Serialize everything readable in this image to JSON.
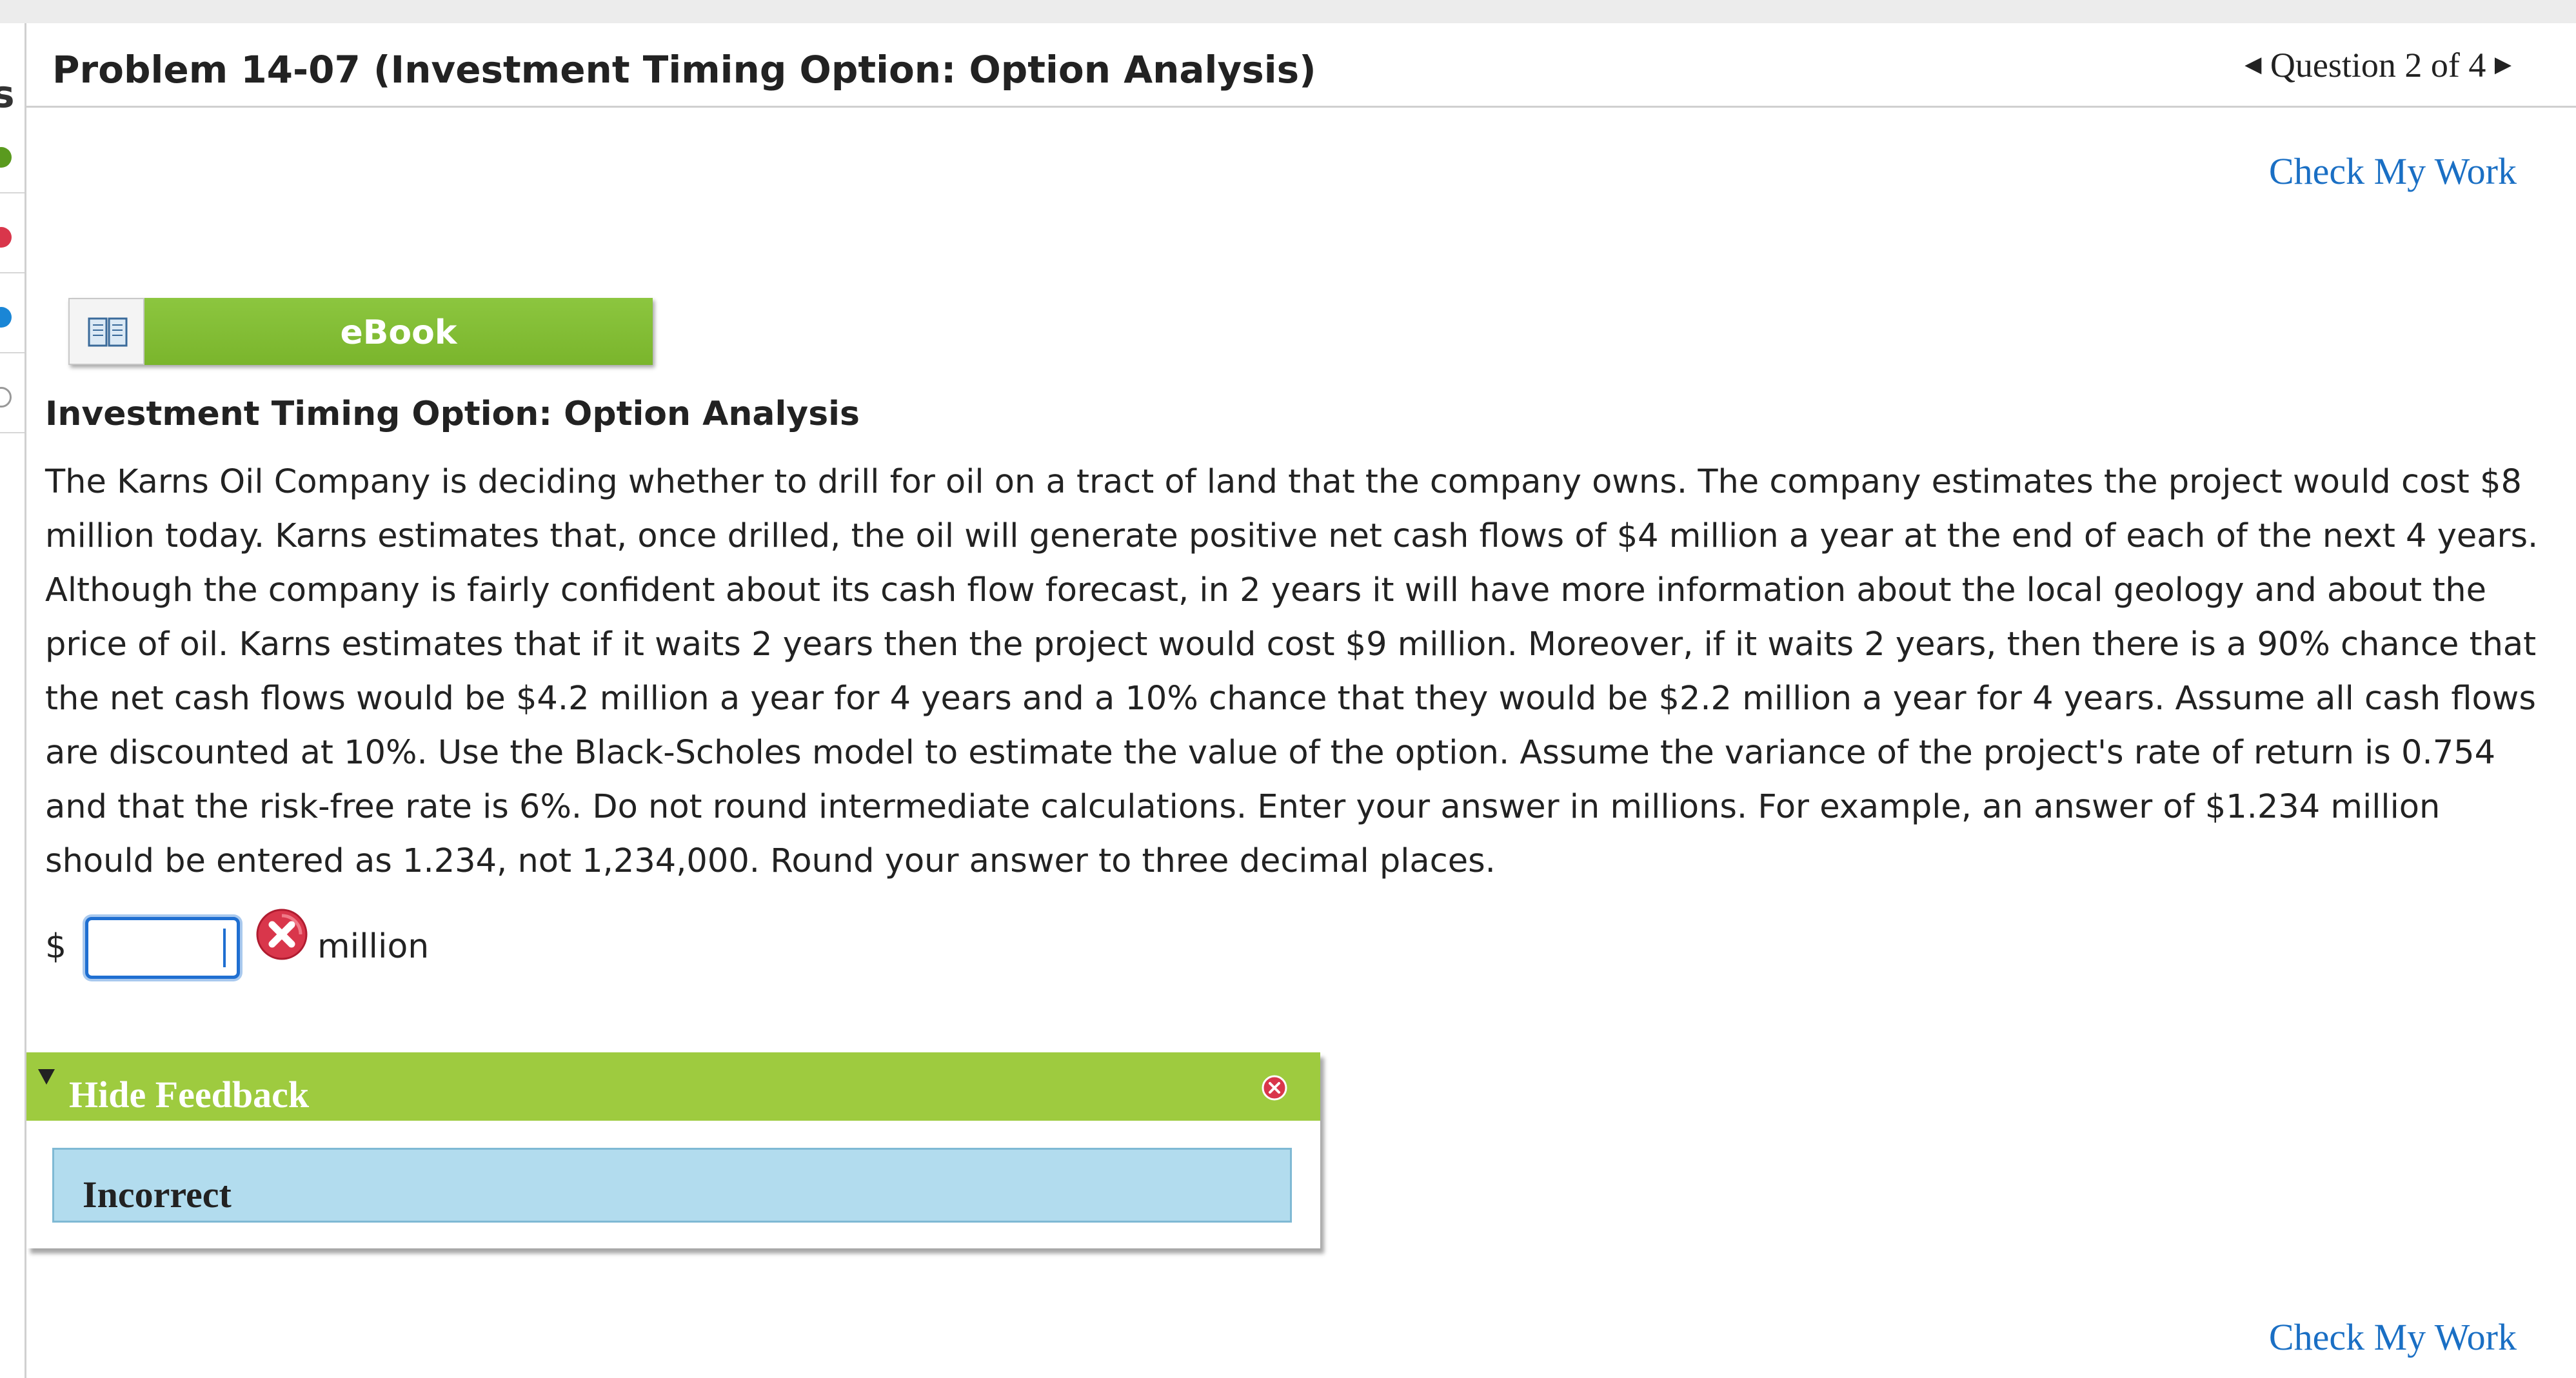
{
  "header": {
    "title": "Problem 14-07 (Investment Timing Option: Option Analysis)",
    "question_nav": "Question 2 of 4",
    "prev_arrow": "◀",
    "next_arrow": "▶"
  },
  "left_rail": {
    "partial_label": "s",
    "status_dots": [
      {
        "state": "correct",
        "color": "#5a9a1e"
      },
      {
        "state": "incorrect",
        "color": "#d9364b"
      },
      {
        "state": "current",
        "color": "#1a86d6"
      },
      {
        "state": "unanswered",
        "color": "#ffffff"
      }
    ]
  },
  "check_my_work_label": "Check My Work",
  "ebook": {
    "label": "eBook",
    "icon": "book-icon"
  },
  "problem": {
    "heading": "Investment Timing Option: Option Analysis",
    "text": "The Karns Oil Company is deciding whether to drill for oil on a tract of land that the company owns. The company estimates the project would cost $8 million today. Karns estimates that, once drilled, the oil will generate positive net cash flows of $4 million a year at the end of each of the next 4 years. Although the company is fairly confident about its cash flow forecast, in 2 years it will have more information about the local geology and about the price of oil. Karns estimates that if it waits 2 years then the project would cost $9 million. Moreover, if it waits 2 years, then there is a 90% chance that the net cash flows would be $4.2 million a year for 4 years and a 10% chance that they would be $2.2 million a year for 4 years. Assume all cash flows are discounted at 10%. Use the Black-Scholes model to estimate the value of the option. Assume the variance of the project's rate of return is 0.754 and that the risk-free rate is 6%. Do not round intermediate calculations. Enter your answer in millions. For example, an answer of $1.234 million should be entered as 1.234, not 1,234,000. Round your answer to three decimal places."
  },
  "answer": {
    "currency": "$",
    "value": "",
    "unit": "million",
    "status_icon": "incorrect-x-icon"
  },
  "feedback": {
    "toggle_label": "Hide Feedback",
    "result": "Incorrect",
    "close_icon": "close-icon"
  },
  "colors": {
    "accent_green": "#8cc63f",
    "feedback_green": "#9ecb3f",
    "link_blue": "#1a6fc4",
    "feedback_blue": "#b2dcee",
    "error_red": "#d9364b"
  }
}
